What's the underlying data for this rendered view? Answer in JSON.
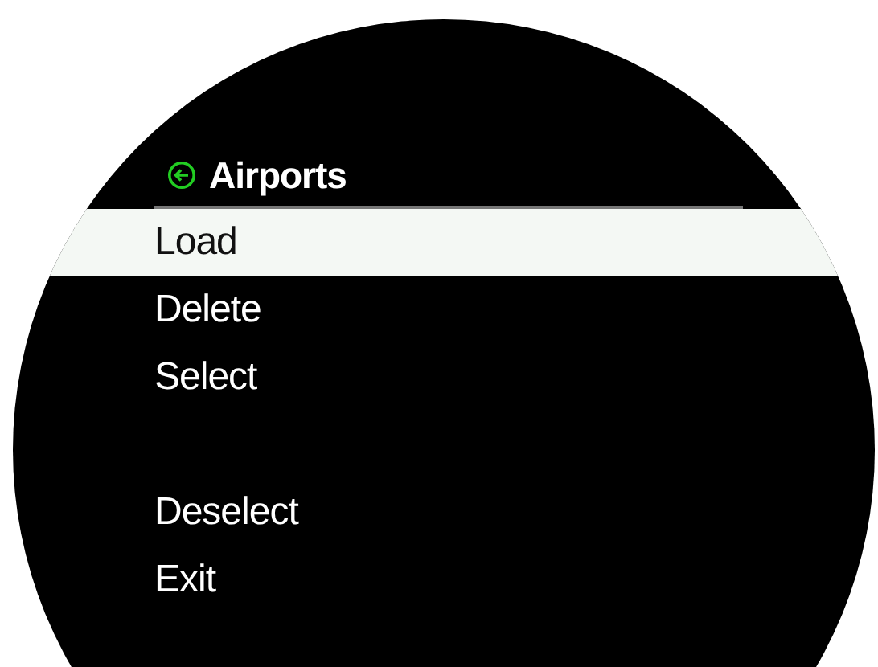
{
  "header": {
    "title": "Airports"
  },
  "menu": [
    {
      "kind": "item",
      "label": "Load",
      "selected": true
    },
    {
      "kind": "item",
      "label": "Delete",
      "selected": false
    },
    {
      "kind": "item",
      "label": "Select",
      "selected": false
    },
    {
      "kind": "spacer"
    },
    {
      "kind": "item",
      "label": "Deselect",
      "selected": false
    },
    {
      "kind": "item",
      "label": "Exit",
      "selected": false
    }
  ]
}
